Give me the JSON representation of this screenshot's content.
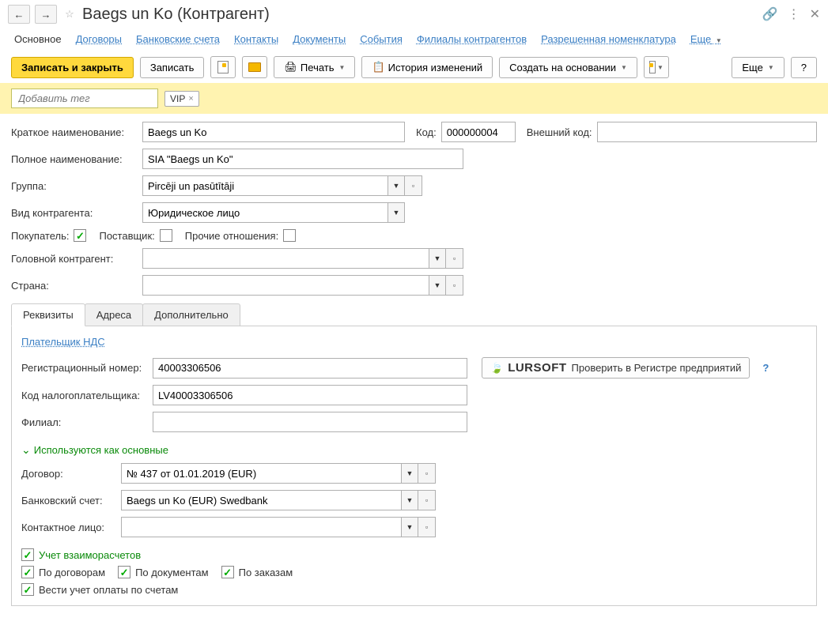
{
  "header": {
    "title": "Baegs un Ko (Контрагент)"
  },
  "nav": {
    "tabs": [
      "Основное",
      "Договоры",
      "Банковские счета",
      "Контакты",
      "Документы",
      "События",
      "Филиалы контрагентов",
      "Разрешенная номенклатура"
    ],
    "more": "Еще"
  },
  "toolbar": {
    "save_close": "Записать и закрыть",
    "save": "Записать",
    "print": "Печать",
    "history": "История изменений",
    "create_basis": "Создать на основании",
    "more": "Еще",
    "help": "?"
  },
  "tags": {
    "placeholder": "Добавить тег",
    "chip": "VIP"
  },
  "fields": {
    "short_name_label": "Краткое наименование:",
    "short_name": "Baegs un Ko",
    "code_label": "Код:",
    "code": "000000004",
    "ext_code_label": "Внешний код:",
    "ext_code": "",
    "full_name_label": "Полное наименование:",
    "full_name": "SIA \"Baegs un Ko\"",
    "group_label": "Группа:",
    "group": "Pircēji un pasūtītāji",
    "type_label": "Вид контрагента:",
    "type": "Юридическое лицо",
    "buyer_label": "Покупатель:",
    "supplier_label": "Поставщик:",
    "other_label": "Прочие отношения:",
    "head_label": "Головной контрагент:",
    "head": "",
    "country_label": "Страна:",
    "country": ""
  },
  "sub_tabs": [
    "Реквизиты",
    "Адреса",
    "Дополнительно"
  ],
  "requisites": {
    "vat_link": "Плательщик НДС",
    "reg_label": "Регистрационный номер:",
    "reg": "40003306506",
    "tax_label": "Код налогоплательщика:",
    "tax": "LV40003306506",
    "branch_label": "Филиал:",
    "branch": "",
    "lursoft": "Проверить в Регистре предприятий"
  },
  "main_defaults": {
    "header": "Используются как основные",
    "contract_label": "Договор:",
    "contract": "№ 437 от 01.01.2019 (EUR)",
    "bank_label": "Банковский счет:",
    "bank": "Baegs un Ko (EUR) Swedbank",
    "contact_label": "Контактное лицо:",
    "contact": ""
  },
  "settlements": {
    "header": "Учет взаиморасчетов",
    "by_contracts": "По договорам",
    "by_docs": "По документам",
    "by_orders": "По заказам",
    "by_invoices": "Вести учет оплаты по счетам"
  }
}
